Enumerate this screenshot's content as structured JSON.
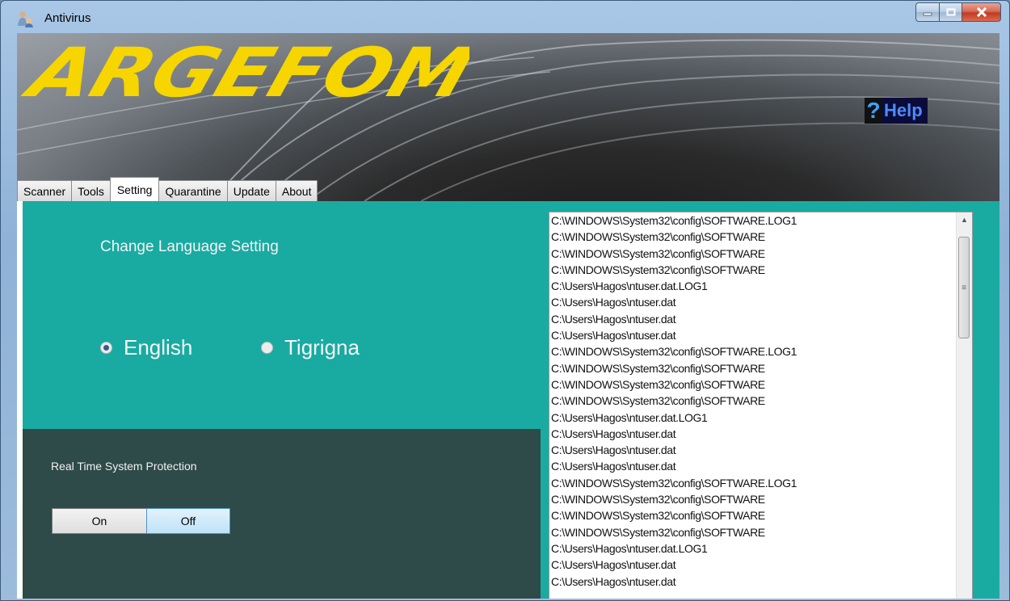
{
  "window": {
    "title": "Antivirus",
    "controls": [
      "minimize",
      "maximize",
      "close"
    ]
  },
  "banner": {
    "logo_text": "ARGEFOM",
    "help": {
      "icon": "?",
      "label": "Help"
    }
  },
  "tabs": [
    {
      "label": "Scanner",
      "active": false
    },
    {
      "label": "Tools",
      "active": false
    },
    {
      "label": "Setting",
      "active": true
    },
    {
      "label": "Quarantine",
      "active": false
    },
    {
      "label": "Update",
      "active": false
    },
    {
      "label": "About",
      "active": false
    }
  ],
  "settings": {
    "language_heading": "Change Language Setting",
    "languages": [
      {
        "label": "English",
        "selected": true
      },
      {
        "label": "Tigrigna",
        "selected": false
      }
    ],
    "protection": {
      "label": "Real Time System Protection",
      "on_label": "On",
      "off_label": "Off",
      "selected": "Off"
    }
  },
  "file_list": [
    "C:\\WINDOWS\\System32\\config\\SOFTWARE.LOG1",
    "C:\\WINDOWS\\System32\\config\\SOFTWARE",
    "C:\\WINDOWS\\System32\\config\\SOFTWARE",
    "C:\\WINDOWS\\System32\\config\\SOFTWARE",
    "C:\\Users\\Hagos\\ntuser.dat.LOG1",
    "C:\\Users\\Hagos\\ntuser.dat",
    "C:\\Users\\Hagos\\ntuser.dat",
    "C:\\Users\\Hagos\\ntuser.dat",
    "C:\\WINDOWS\\System32\\config\\SOFTWARE.LOG1",
    "C:\\WINDOWS\\System32\\config\\SOFTWARE",
    "C:\\WINDOWS\\System32\\config\\SOFTWARE",
    "C:\\WINDOWS\\System32\\config\\SOFTWARE",
    "C:\\Users\\Hagos\\ntuser.dat.LOG1",
    "C:\\Users\\Hagos\\ntuser.dat",
    "C:\\Users\\Hagos\\ntuser.dat",
    "C:\\Users\\Hagos\\ntuser.dat",
    "C:\\WINDOWS\\System32\\config\\SOFTWARE.LOG1",
    "C:\\WINDOWS\\System32\\config\\SOFTWARE",
    "C:\\WINDOWS\\System32\\config\\SOFTWARE",
    "C:\\WINDOWS\\System32\\config\\SOFTWARE",
    "C:\\Users\\Hagos\\ntuser.dat.LOG1",
    "C:\\Users\\Hagos\\ntuser.dat",
    "C:\\Users\\Hagos\\ntuser.dat"
  ],
  "colors": {
    "panel_teal": "#19aba2",
    "panel_dark": "#2e4a49",
    "logo_yellow": "#f6d500",
    "help_blue": "#4b8cff"
  }
}
